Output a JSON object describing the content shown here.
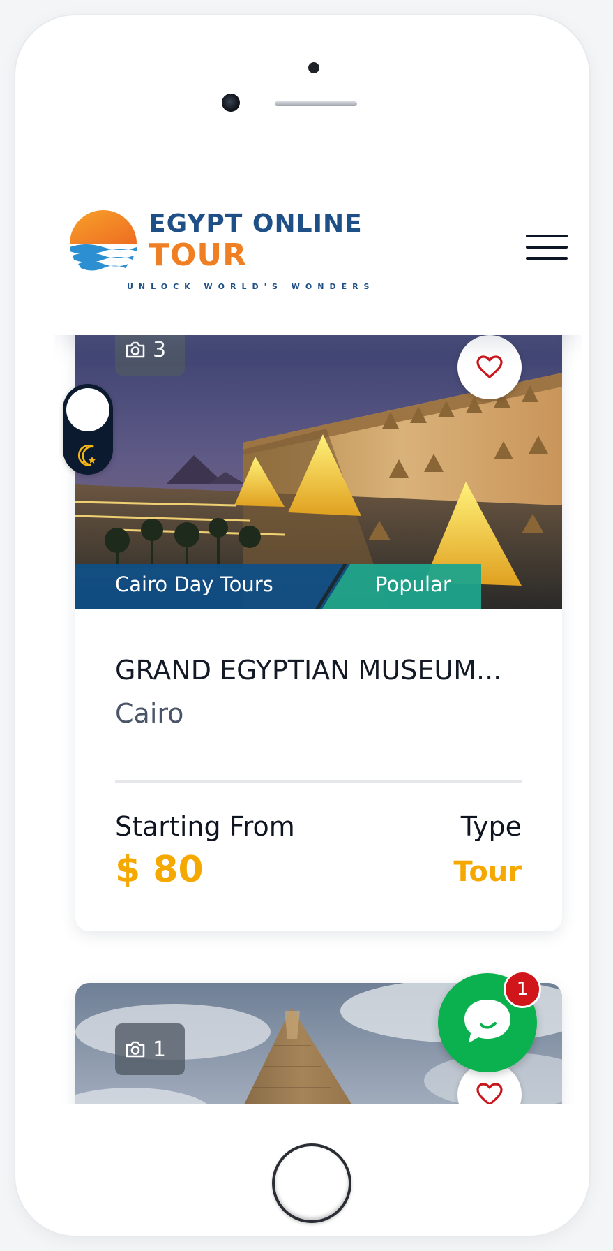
{
  "header": {
    "logo_title": "EGYPT ONLINE",
    "logo_subtitle": "TOUR",
    "logo_tagline": "UNLOCK WORLD'S WONDERS"
  },
  "tours": [
    {
      "photo_count": "3",
      "category": "Cairo Day Tours",
      "badge": "Popular",
      "title": "GRAND EGYPTIAN MUSEUM...",
      "city": "Cairo",
      "price_label": "Starting From",
      "price": "$ 80",
      "type_label": "Type",
      "type": "Tour"
    },
    {
      "photo_count": "1"
    }
  ],
  "chat": {
    "unread_count": "1"
  },
  "icons": {
    "menu": "hamburger-menu-icon",
    "camera": "camera-icon",
    "favorite": "heart-icon",
    "theme": "moon-stars-icon",
    "chat": "chat-bubble-icon"
  },
  "colors": {
    "brand_blue": "#1e4f86",
    "brand_orange": "#f07f23",
    "accent_price": "#f5a800",
    "category_blue": "#0f4f86",
    "badge_teal": "#1ea48c",
    "chat_green": "#0bb04f",
    "badge_red": "#d0161b"
  }
}
